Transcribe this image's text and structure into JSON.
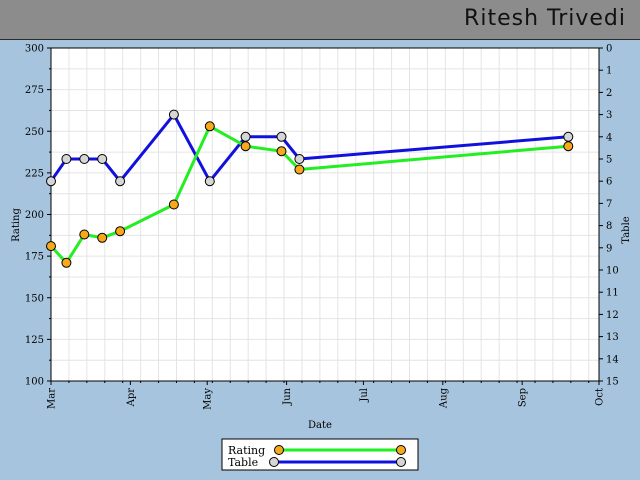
{
  "header": {
    "title": "Ritesh Trivedi"
  },
  "chart_data": {
    "type": "line",
    "xlabel": "Date",
    "ylabel": "Rating",
    "y2label": "Table",
    "x_ticks": [
      "Mar",
      "Apr",
      "May",
      "Jun",
      "Jul",
      "Aug",
      "Sep",
      "Oct"
    ],
    "ylim": [
      100,
      300
    ],
    "y_ticks": [
      "100",
      "125",
      "150",
      "175",
      "200",
      "225",
      "250",
      "275",
      "300"
    ],
    "y2lim": [
      0,
      15
    ],
    "y2_reversed": true,
    "y2_ticks": [
      "0",
      "1",
      "2",
      "3",
      "4",
      "5",
      "6",
      "7",
      "8",
      "9",
      "10",
      "11",
      "12",
      "13",
      "14",
      "15"
    ],
    "grid": true,
    "legend_position": "bottom-center",
    "series": [
      {
        "name": "Rating",
        "axis": "left",
        "color": "#22ee22",
        "marker_color": "#f7a81b",
        "points": [
          {
            "x": "Mar 1",
            "y": 181
          },
          {
            "x": "Mar 7",
            "y": 171
          },
          {
            "x": "Mar 14",
            "y": 188
          },
          {
            "x": "Mar 21",
            "y": 186
          },
          {
            "x": "Mar 28",
            "y": 190
          },
          {
            "x": "Apr 18",
            "y": 206
          },
          {
            "x": "May 2",
            "y": 253
          },
          {
            "x": "May 16",
            "y": 241
          },
          {
            "x": "May 30",
            "y": 238
          },
          {
            "x": "Jun 6",
            "y": 227
          },
          {
            "x": "Sep 19",
            "y": 241
          }
        ]
      },
      {
        "name": "Table",
        "axis": "right",
        "color": "#1111dd",
        "marker_color": "#d6d6d6",
        "points": [
          {
            "x": "Mar 1",
            "y": 6
          },
          {
            "x": "Mar 7",
            "y": 5
          },
          {
            "x": "Mar 14",
            "y": 5
          },
          {
            "x": "Mar 21",
            "y": 5
          },
          {
            "x": "Mar 28",
            "y": 6
          },
          {
            "x": "Apr 18",
            "y": 3
          },
          {
            "x": "May 2",
            "y": 6
          },
          {
            "x": "May 16",
            "y": 4
          },
          {
            "x": "May 30",
            "y": 4
          },
          {
            "x": "Jun 6",
            "y": 5
          },
          {
            "x": "Sep 19",
            "y": 4
          }
        ]
      }
    ]
  }
}
